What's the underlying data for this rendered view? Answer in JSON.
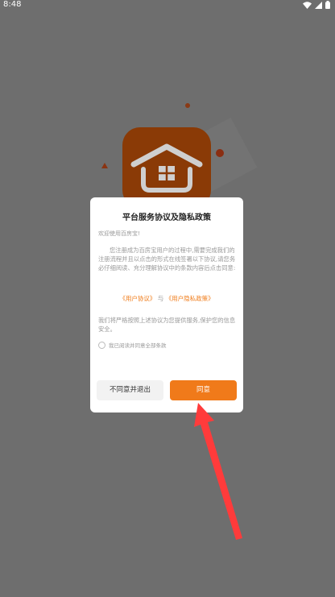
{
  "status_bar": {
    "time": "8:48",
    "icons": [
      "wifi-icon",
      "signal-icon",
      "battery-icon"
    ]
  },
  "dialog": {
    "title": "平台服务协议及隐私政策",
    "greeting": "欢迎使用百房宝!",
    "body": "您注册成为百房宝用户的过程中,需要完成我们的注册流程并且以点击的形式在线签署以下协议,请您务必仔细阅读、充分理解协议中的条款内容后点击同意:",
    "user_agreement_link": "《用户协议》",
    "conjunction": "与",
    "privacy_policy_link": "《用户隐私政策》",
    "notice": "我们将严格按照上述协议为您提供服务,保护您的信息安全。",
    "agree_checkbox_label": "我已阅读并同意全部条款",
    "decline_button": "不同意并退出",
    "agree_button": "同意"
  },
  "colors": {
    "accent": "#f07a1a",
    "link": "#f07c1a",
    "overlay": "#6e6e6e",
    "annotation_arrow": "#ff3b3b"
  }
}
